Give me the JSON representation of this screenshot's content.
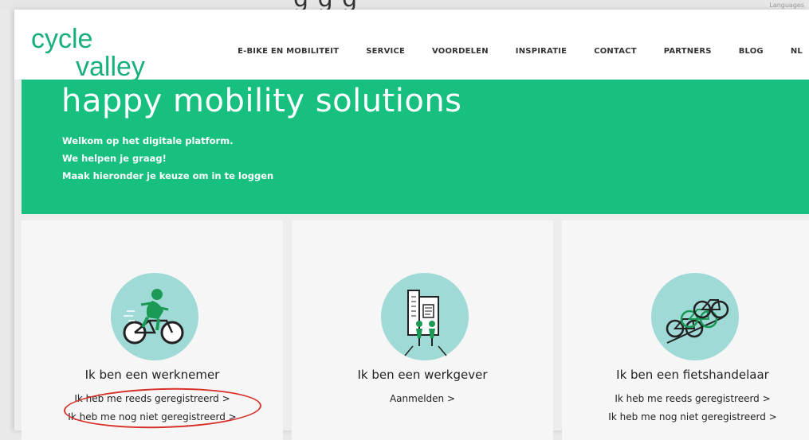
{
  "browser_top": {
    "ghost_text": "g   g   g",
    "lang_label": "Languages"
  },
  "header": {
    "logo_line1": "cycle",
    "logo_line2": "valley",
    "nav": [
      "E-BIKE EN MOBILITEIT",
      "SERVICE",
      "VOORDELEN",
      "INSPIRATIE",
      "CONTACT",
      "PARTNERS",
      "BLOG"
    ],
    "lang": "NL"
  },
  "hero": {
    "title": "happy mobility solutions",
    "lines": [
      "Welkom op het digitale platform.",
      "We helpen je graag!",
      "Maak hieronder je keuze om in te loggen"
    ]
  },
  "cards": [
    {
      "title": "Ik ben een werknemer",
      "links": [
        "Ik heb me reeds geregistreerd >",
        "Ik heb me nog niet geregistreerd >"
      ],
      "icon": "cyclist-icon"
    },
    {
      "title": "Ik ben een werkgever",
      "links": [
        "Aanmelden >"
      ],
      "icon": "office-building-cyclists-icon"
    },
    {
      "title": "Ik ben een fietshandelaar",
      "links": [
        "Ik heb me reeds geregistreerd >",
        "Ik heb me nog niet geregistreerd >"
      ],
      "icon": "bike-rack-icon"
    }
  ],
  "colors": {
    "brand_green": "#17c07e",
    "icon_circle": "#9fdad6",
    "annotation_red": "#d8312b"
  }
}
